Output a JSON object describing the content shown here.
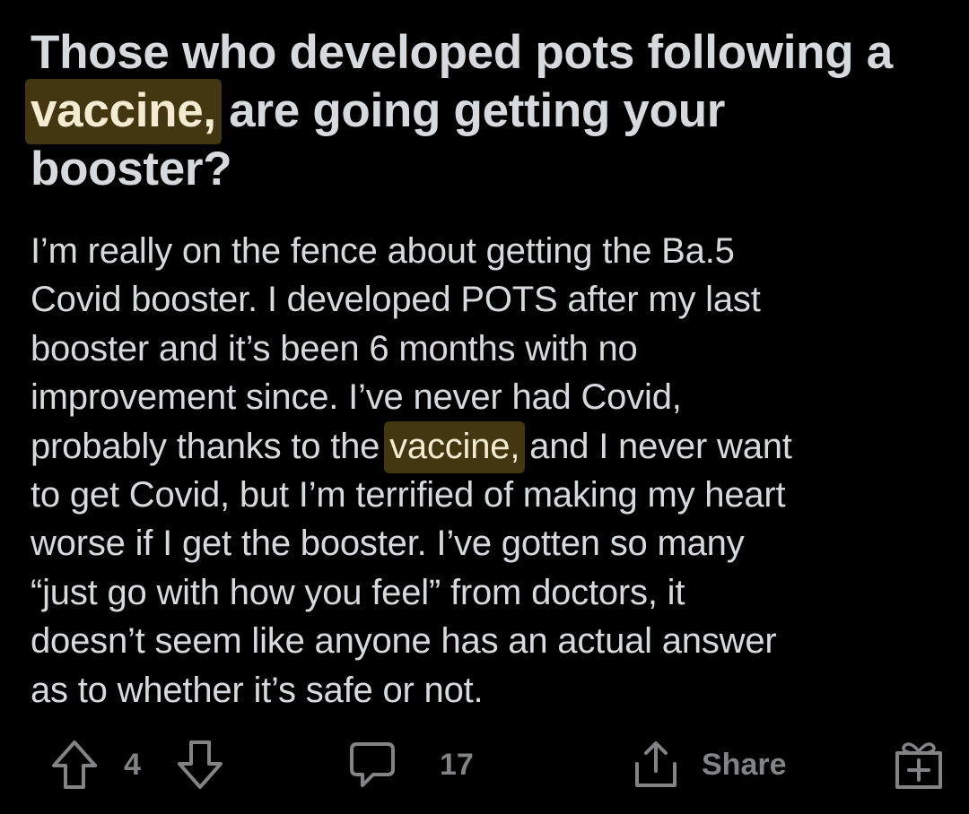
{
  "post": {
    "title": {
      "before": "Those who developed pots following a",
      "highlight": "vaccine,",
      "after_line2": " are going getting your",
      "line3": "booster?"
    },
    "body": {
      "l1": "I’m really on the fence about getting the Ba.5",
      "l2": "Covid booster. I developed POTS after my last",
      "l3": "booster and it’s been 6 months with no",
      "l4": "improvement since. I’ve never had Covid,",
      "l5_before": "probably thanks to the ",
      "l5_highlight": "vaccine,",
      "l5_after": " and I never want",
      "l6": "to get Covid, but I’m terrified of making my heart",
      "l7": "worse if I get the booster. I’ve gotten so many",
      "l8": "“just go with how you feel” from doctors, it",
      "l9": "doesn’t seem like anyone has an actual answer",
      "l10": "as to whether it’s safe or not."
    }
  },
  "actions": {
    "vote_count": "4",
    "comment_count": "17",
    "share_label": "Share",
    "icons": {
      "upvote": "upvote-arrow-icon",
      "downvote": "downvote-arrow-icon",
      "comments": "comment-bubble-icon",
      "share": "share-icon",
      "award": "award-gift-icon"
    }
  },
  "colors": {
    "background": "#000000",
    "text": "#d7dadc",
    "muted": "#818384",
    "highlight": "#6e5b1c"
  }
}
